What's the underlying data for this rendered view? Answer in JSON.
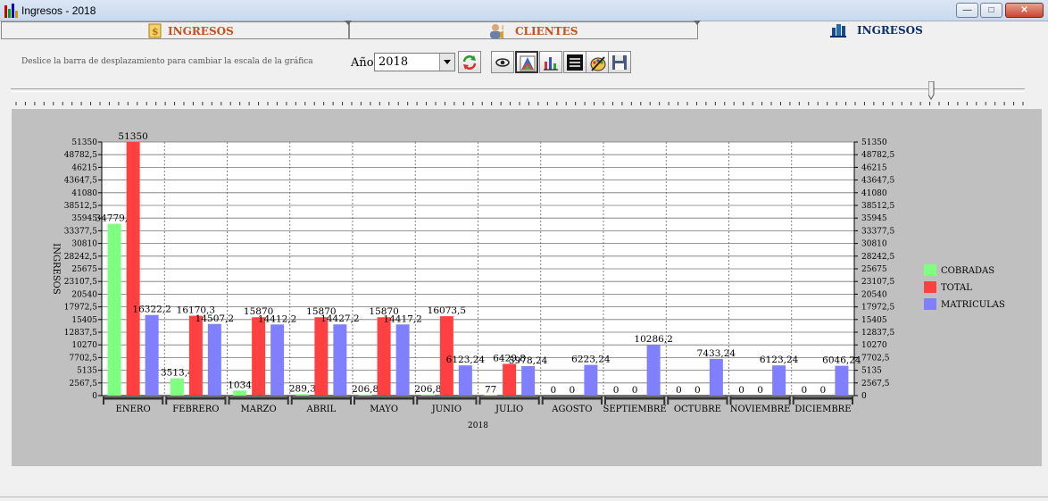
{
  "window": {
    "title": "Ingresos - 2018"
  },
  "tabs": [
    {
      "label": "INGRESOS"
    },
    {
      "label": "CLIENTES"
    },
    {
      "label": "INGRESOS"
    }
  ],
  "toolbar": {
    "hint": "Deslice la barra de desplazamiento para cambiar la escala de la gráfica",
    "year_label": "Año",
    "year_value": "2018"
  },
  "colors": {
    "cobradas": "#7fff7f",
    "total": "#ff4040",
    "matriculas": "#8080ff",
    "panel": "#c0c0c0"
  },
  "chart_data": {
    "type": "bar",
    "ylabel": "INGRESOS",
    "xlabel": "2018",
    "categories": [
      "ENERO",
      "FEBRERO",
      "MARZO",
      "ABRIL",
      "MAYO",
      "JUNIO",
      "JULIO",
      "AGOSTO",
      "SEPTIEMBRE",
      "OCTUBRE",
      "NOVIEMBRE",
      "DICIEMBRE"
    ],
    "series": [
      {
        "name": "COBRADAS",
        "values": [
          34779.8,
          3513.4,
          1034,
          289.3,
          206.8,
          206.8,
          77,
          0,
          0,
          0,
          0,
          0
        ],
        "labels": [
          "34779,8",
          "3513,4",
          "1034",
          "289,3",
          "206,8",
          "206,8",
          "77",
          "0",
          "0",
          "0",
          "0",
          "0"
        ]
      },
      {
        "name": "TOTAL",
        "values": [
          51350,
          16170.3,
          15870,
          15870,
          15870,
          16073.5,
          6429.8,
          0,
          0,
          0,
          0,
          0
        ],
        "labels": [
          "51350",
          "16170,3",
          "15870",
          "15870",
          "15870",
          "16073,5",
          "6429,8",
          "0",
          "0",
          "0",
          "0",
          "0"
        ]
      },
      {
        "name": "MATRICULAS",
        "values": [
          16322.2,
          14507.2,
          14412.2,
          14427.2,
          14417.2,
          6123.24,
          5978.24,
          6223.24,
          10286.2,
          7433.24,
          6123.24,
          6046.24
        ],
        "labels": [
          "16322,2",
          "14507,2",
          "14412,2",
          "14427,2",
          "14417,2",
          "6123,24",
          "5978,24",
          "6223,24",
          "10286,2",
          "7433,24",
          "6123,24",
          "6046,24"
        ]
      }
    ],
    "yticks": [
      "0",
      "2567,5",
      "5135",
      "7702,5",
      "10270",
      "12837,5",
      "15405",
      "17972,5",
      "20540",
      "23107,5",
      "25675",
      "28242,5",
      "30810",
      "33377,5",
      "35945",
      "38512,5",
      "41080",
      "43647,5",
      "46215",
      "48782,5",
      "51350"
    ],
    "ylim": [
      0,
      51350
    ],
    "grid": true,
    "legend": "right"
  }
}
